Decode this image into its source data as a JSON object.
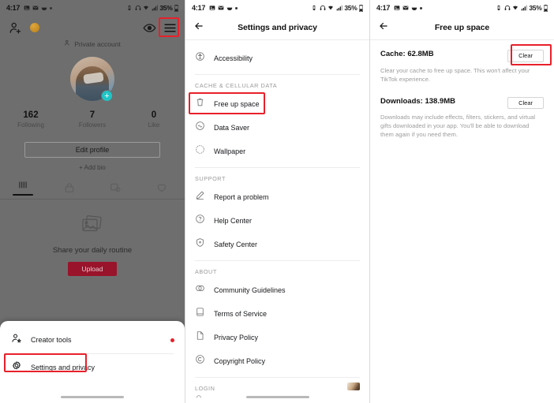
{
  "status_bar": {
    "time": "4:17",
    "battery_pct": "35%",
    "left_icons": [
      "photo-icon",
      "mail-icon",
      "food-icon",
      "dot-icon"
    ],
    "right_icons": [
      "vibrate-icon",
      "headphones-icon",
      "wifi-icon",
      "signal-icon",
      "battery-icon"
    ]
  },
  "panel_profile": {
    "top_bar": {
      "add_person_icon": "add-person-icon",
      "coin_icon": "gold-coin-icon",
      "eye_icon": "eye-icon",
      "menu_icon": "hamburger-menu-icon"
    },
    "private_account_label": "Private account",
    "stats": [
      {
        "value": "162",
        "label": "Following"
      },
      {
        "value": "7",
        "label": "Followers"
      },
      {
        "value": "0",
        "label": "Like"
      }
    ],
    "edit_profile_label": "Edit profile",
    "add_bio_label": "+ Add bio",
    "tabs": [
      "grid-icon",
      "lock-icon",
      "repost-icon",
      "liked-heart-icon"
    ],
    "empty_state": {
      "title": "Share your daily routine",
      "button_label": "Upload"
    },
    "sheet": {
      "items": [
        {
          "label": "Creator tools",
          "icon": "creator-tools-icon",
          "badge": true
        },
        {
          "label": "Settings and privacy",
          "icon": "gear-icon",
          "badge": false
        }
      ]
    },
    "highlights": [
      "menu-icon-highlight",
      "settings-and-privacy-highlight"
    ]
  },
  "panel_settings": {
    "nav": {
      "back_icon": "back-arrow-icon",
      "title": "Settings and privacy"
    },
    "groups": [
      {
        "header": "",
        "items": [
          {
            "label": "Accessibility",
            "icon": "accessibility-icon"
          }
        ]
      },
      {
        "header": "CACHE & CELLULAR DATA",
        "items": [
          {
            "label": "Free up space",
            "icon": "trash-icon",
            "highlighted": true
          },
          {
            "label": "Data Saver",
            "icon": "data-saver-icon"
          },
          {
            "label": "Wallpaper",
            "icon": "wallpaper-icon"
          }
        ]
      },
      {
        "header": "SUPPORT",
        "items": [
          {
            "label": "Report a problem",
            "icon": "pencil-icon"
          },
          {
            "label": "Help Center",
            "icon": "question-circle-icon"
          },
          {
            "label": "Safety Center",
            "icon": "shield-icon"
          }
        ]
      },
      {
        "header": "ABOUT",
        "items": [
          {
            "label": "Community Guidelines",
            "icon": "community-icon"
          },
          {
            "label": "Terms of Service",
            "icon": "book-icon"
          },
          {
            "label": "Privacy Policy",
            "icon": "document-icon"
          },
          {
            "label": "Copyright Policy",
            "icon": "copyright-icon"
          }
        ]
      },
      {
        "header": "LOGIN",
        "items": []
      }
    ]
  },
  "panel_freeup": {
    "nav": {
      "back_icon": "back-arrow-icon",
      "title": "Free up space"
    },
    "cards": [
      {
        "title": "Cache: 62.8MB",
        "description": "Clear your cache to free up space. This won't affect your TikTok experience.",
        "button_label": "Clear",
        "highlighted": true
      },
      {
        "title": "Downloads: 138.9MB",
        "description": "Downloads may include effects, filters, stickers, and virtual gifts downloaded in your app. You'll be able to download them again if you need them.",
        "button_label": "Clear",
        "highlighted": false
      }
    ]
  },
  "colors": {
    "highlight_red": "#e8202a",
    "brand_red": "#99142b",
    "accent_teal": "#1ec6c6"
  }
}
